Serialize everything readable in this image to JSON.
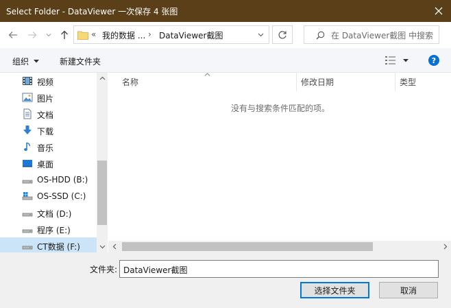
{
  "window": {
    "title": "Select Folder - DataViewer 一次保存 4 张图",
    "close_glyph": "✕"
  },
  "nav": {
    "back_glyph": "←",
    "forward_glyph": "→",
    "recent_glyph": "⌄",
    "up_glyph": "↑",
    "breadcrumb_prefix": "«",
    "breadcrumb_parent": "我的数据 ...",
    "breadcrumb_sep": "›",
    "breadcrumb_current": "DataViewer截图",
    "dropdown_glyph": "⌄",
    "refresh_glyph": "↻",
    "search_placeholder": "在 DataViewer截图 中搜索"
  },
  "toolbar": {
    "organize_label": "组织",
    "new_folder_label": "新建文件夹",
    "help_glyph": "?"
  },
  "sidebar": {
    "items": [
      {
        "label": "视频",
        "icon": "video-icon"
      },
      {
        "label": "图片",
        "icon": "pictures-icon"
      },
      {
        "label": "文档",
        "icon": "documents-icon"
      },
      {
        "label": "下载",
        "icon": "download-icon"
      },
      {
        "label": "音乐",
        "icon": "music-icon"
      },
      {
        "label": "桌面",
        "icon": "desktop-icon"
      },
      {
        "label": "OS-HDD (B:)",
        "icon": "drive-icon"
      },
      {
        "label": "OS-SSD (C:)",
        "icon": "windows-drive-icon"
      },
      {
        "label": "文档 (D:)",
        "icon": "drive-icon"
      },
      {
        "label": "程序 (E:)",
        "icon": "drive-icon"
      },
      {
        "label": "CT数据 (F:)",
        "icon": "drive-icon",
        "selected": true
      }
    ]
  },
  "content": {
    "columns": [
      "名称",
      "修改日期",
      "类型"
    ],
    "empty_message": "没有与搜索条件匹配的项。"
  },
  "bottom": {
    "folder_label": "文件夹:",
    "folder_value": "DataViewer截图",
    "select_button": "选择文件夹",
    "cancel_button": "取消"
  },
  "colors": {
    "titlebar": "#5a3f18",
    "accent": "#0078d7",
    "selection": "#cce4f7"
  }
}
